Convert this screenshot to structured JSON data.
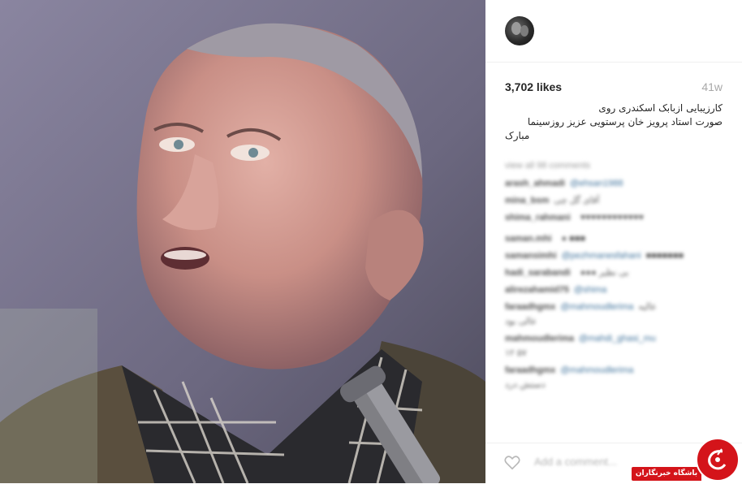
{
  "post": {
    "likes": "3,702 likes",
    "time_ago": "41w",
    "caption": [
      "کارزیبایی ازبابک اسکندری روی",
      "صورت استاد پرویز خان پرستویی عزیز روزسینما",
      "مبارک"
    ],
    "view_all": "view all 98 comments",
    "comments": [
      {
        "user": "arash_ahmadi",
        "mention": "@ehsan1988",
        "text": ""
      },
      {
        "user": "mina_bsm",
        "mention": "",
        "text": "آقای گل چی"
      },
      {
        "user": "shima_rahmani",
        "mention": "",
        "text": "♥♥♥♥♥♥♥♥♥♥♥♥"
      },
      {
        "user": "saman.mhi",
        "mention": "",
        "text": "● ■■■"
      },
      {
        "user": "samansimhi",
        "mention": "@pezhmanesfahani",
        "text": "■■■■■■■"
      },
      {
        "user": "hadi_sarabandi",
        "mention": "",
        "text": "●●● بی نظیر"
      },
      {
        "user": "alirezahamid75",
        "mention": "@shima",
        "text": ""
      },
      {
        "user": "faraadhgmx",
        "mention": "@mahmoudlerima",
        "text": "عالیه"
      },
      {
        "user": "",
        "mention": "",
        "text": "عالی بود"
      },
      {
        "user": "mahmoudlerima",
        "mention": "@mahdi_ghasi_mu",
        "text": ""
      },
      {
        "user": "",
        "mention": "",
        "text": "۱۲ ۵۷"
      },
      {
        "user": "faraadhgmx",
        "mention": "@mahmoudlerima",
        "text": ""
      },
      {
        "user": "",
        "mention": "",
        "text": "دستش درد"
      }
    ],
    "add_comment_placeholder": "Add a comment...",
    "icons": {
      "avatar": "profile-avatar",
      "heart": "heart-outline-icon"
    }
  },
  "watermark": {
    "text": "باشگاه خبرنگاران",
    "color": "#d4141a"
  }
}
